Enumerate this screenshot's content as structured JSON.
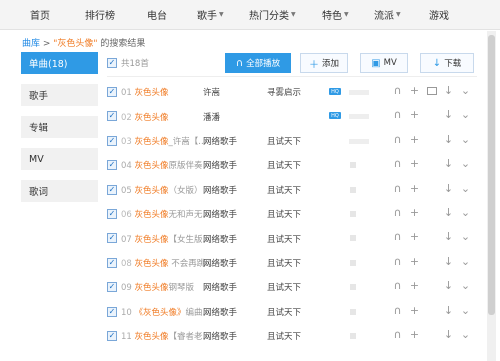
{
  "nav": {
    "items": [
      {
        "label": "首页",
        "caret": false
      },
      {
        "label": "排行榜",
        "caret": false
      },
      {
        "label": "电台",
        "caret": false
      },
      {
        "label": "歌手",
        "caret": true
      },
      {
        "label": "热门分类",
        "caret": true
      },
      {
        "label": "特色",
        "caret": true
      },
      {
        "label": "流派",
        "caret": true
      },
      {
        "label": "游戏",
        "caret": false
      }
    ]
  },
  "breadcrumb": {
    "root": "曲库",
    "sep": " > ",
    "query": "\"灰色头像\"",
    "suffix": " 的搜索结果"
  },
  "sidebar": {
    "items": [
      {
        "label": "单曲(18)",
        "active": true
      },
      {
        "label": "歌手",
        "active": false
      },
      {
        "label": "专辑",
        "active": false
      },
      {
        "label": "MV",
        "active": false
      },
      {
        "label": "歌词",
        "active": false
      }
    ]
  },
  "toolbar": {
    "total": "共18首",
    "play_all": "全部播放",
    "add": "添加",
    "mv": "MV",
    "download": "下载"
  },
  "rows": [
    {
      "index": "01",
      "title": "灰色头像",
      "title_extra": "",
      "artist": "许嵩",
      "album": "寻雾启示",
      "hq": true,
      "style": "bar",
      "gray": false
    },
    {
      "index": "02",
      "title": "灰色头像",
      "title_extra": "",
      "artist": "潘潘",
      "album": "",
      "hq": true,
      "style": "bar",
      "gray": true
    },
    {
      "index": "03",
      "title": "灰色头像",
      "title_extra": "_许嵩【...",
      "artist": "网络歌手",
      "album": "且试天下",
      "hq": false,
      "style": "bar",
      "gray": true
    },
    {
      "index": "04",
      "title": "灰色头像",
      "title_extra": "原版伴奏",
      "artist": "网络歌手",
      "album": "且试天下",
      "hq": false,
      "style": "sq",
      "gray": false
    },
    {
      "index": "05",
      "title": "灰色头像",
      "title_extra": "（女版）",
      "artist": "网络歌手",
      "album": "且试天下",
      "hq": false,
      "style": "sq",
      "gray": false
    },
    {
      "index": "06",
      "title": "灰色头像",
      "title_extra": "无和声无...",
      "artist": "网络歌手",
      "album": "且试天下",
      "hq": false,
      "style": "sq",
      "gray": true
    },
    {
      "index": "07",
      "title": "灰色头像",
      "title_extra": "【女生版...",
      "artist": "网络歌手",
      "album": "且试天下",
      "hq": false,
      "style": "sq",
      "gray": false
    },
    {
      "index": "08",
      "title": "灰色头像",
      "title_extra": " 不会再跳...",
      "artist": "网络歌手",
      "album": "且试天下",
      "hq": false,
      "style": "sq",
      "gray": true
    },
    {
      "index": "09",
      "title": "灰色头像",
      "title_extra": "钢琴版",
      "artist": "网络歌手",
      "album": "且试天下",
      "hq": false,
      "style": "sq",
      "gray": false
    },
    {
      "index": "10",
      "title": "《灰色头像》",
      "title_extra": "编曲...",
      "artist": "网络歌手",
      "album": "且试天下",
      "hq": false,
      "style": "sq",
      "gray": false
    },
    {
      "index": "11",
      "title": "灰色头像",
      "title_extra": "【睿者老...",
      "artist": "网络歌手",
      "album": "且试天下",
      "hq": false,
      "style": "sq",
      "gray": false
    }
  ],
  "row_actions": {
    "listen": "∩",
    "add": "+",
    "download": "↓",
    "more": "⌄"
  },
  "colors": {
    "accent": "#2f9ae5",
    "highlight": "#f07a22"
  }
}
